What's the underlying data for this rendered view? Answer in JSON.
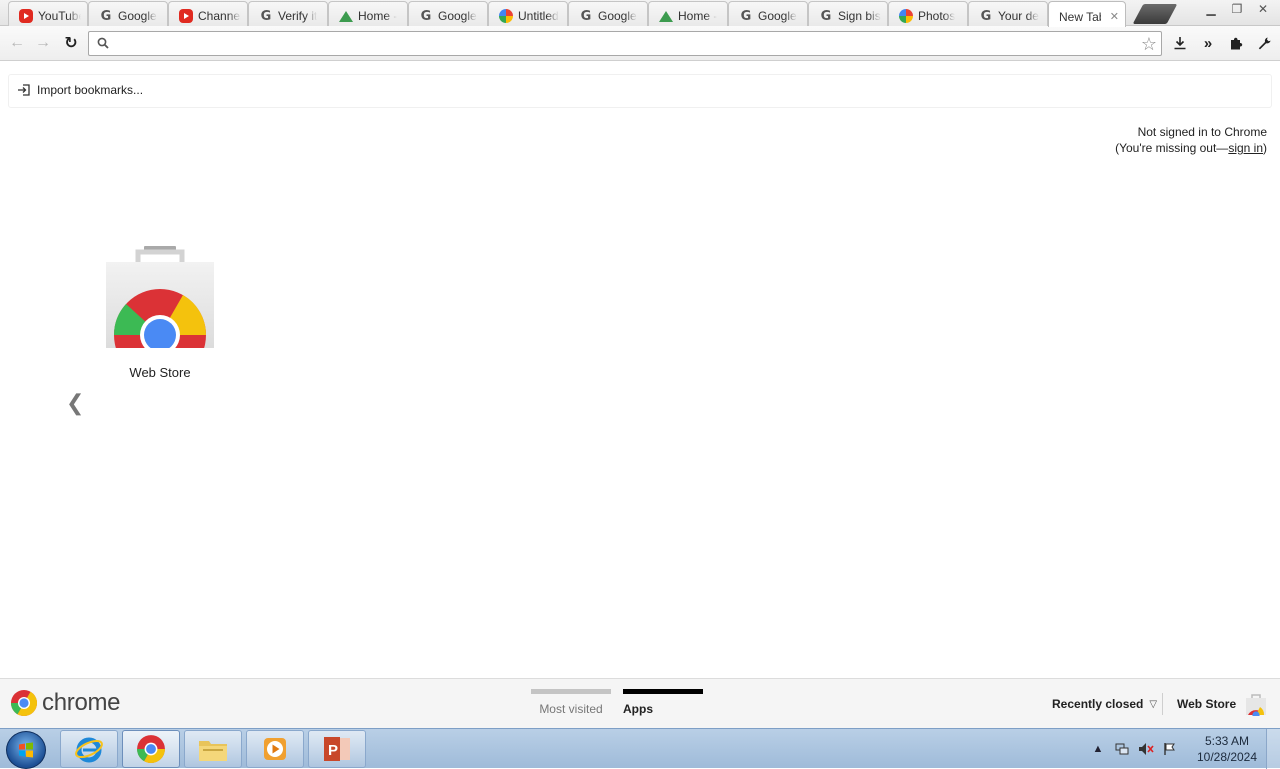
{
  "browser": {
    "tabs": [
      {
        "label": "YouTube",
        "favicon": "youtube-icon"
      },
      {
        "label": "Google",
        "favicon": "google-icon"
      },
      {
        "label": "Channel",
        "favicon": "youtube-icon"
      },
      {
        "label": "Verify it",
        "favicon": "google-icon"
      },
      {
        "label": "Home -",
        "favicon": "drive-icon"
      },
      {
        "label": "Google",
        "favicon": "google-icon"
      },
      {
        "label": "Untitled",
        "favicon": "pinwheel-icon"
      },
      {
        "label": "Google",
        "favicon": "google-icon"
      },
      {
        "label": "Home -",
        "favicon": "drive-icon"
      },
      {
        "label": "Google",
        "favicon": "google-icon"
      },
      {
        "label": "Sign bis",
        "favicon": "google-icon"
      },
      {
        "label": "Photos",
        "favicon": "pinwheel-icon"
      },
      {
        "label": "Your de",
        "favicon": "google-icon"
      },
      {
        "label": "New Tab",
        "favicon": "",
        "active": true
      }
    ],
    "omnibox": {
      "value": "",
      "placeholder": ""
    }
  },
  "bookmarks_bar": {
    "import_label": "Import bookmarks..."
  },
  "signin_promo": {
    "line1": "Not signed in to Chrome",
    "line2_prefix": "(You're missing out—",
    "link": "sign in",
    "line2_suffix": ")"
  },
  "apps": [
    {
      "label": "Web Store",
      "icon": "web-store-icon"
    }
  ],
  "footer": {
    "wordmark": "chrome",
    "most_visited": "Most visited",
    "apps": "Apps",
    "recently_closed": "Recently closed",
    "web_store": "Web Store"
  },
  "taskbar": {
    "pinned": [
      "internet-explorer-icon",
      "chrome-icon",
      "file-explorer-icon",
      "media-player-icon",
      "powerpoint-icon"
    ],
    "time": "5:33 AM",
    "date": "10/28/2024"
  },
  "colors": {
    "taskbar": "#a9c3df",
    "active_page_indicator": "#000000",
    "inactive_page_indicator": "#c4c4c4"
  }
}
